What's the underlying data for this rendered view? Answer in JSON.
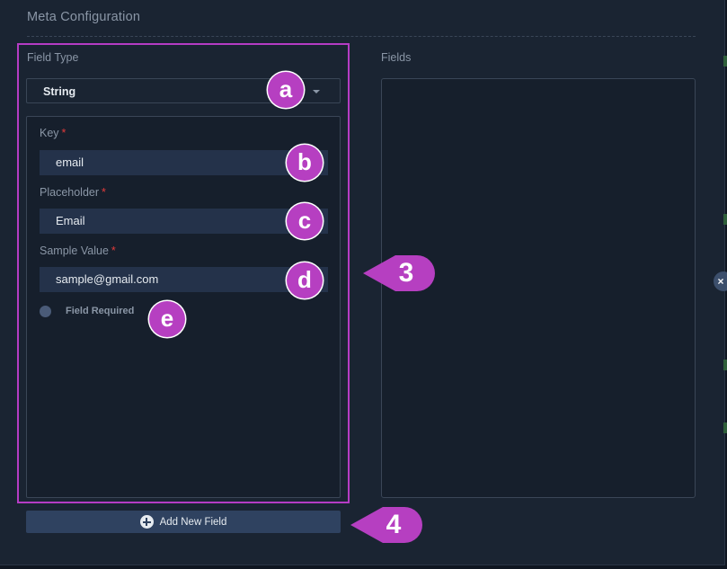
{
  "panel": {
    "title": "Meta Configuration"
  },
  "left": {
    "field_type_label": "Field Type",
    "field_type_value": "String",
    "key_label": "Key",
    "key_value": "email",
    "placeholder_label": "Placeholder",
    "placeholder_value": "Email",
    "sample_label": "Sample Value",
    "sample_value": "sample@gmail.com",
    "required_marker": "*",
    "field_required_label": "Field Required",
    "field_required_checked": false
  },
  "right": {
    "fields_label": "Fields"
  },
  "footer": {
    "add_button_label": "Add New Field"
  },
  "close_button_label": "×",
  "annotations": {
    "a": "a",
    "b": "b",
    "c": "c",
    "d": "d",
    "e": "e",
    "three": "3",
    "four": "4"
  },
  "colors": {
    "annotation": "#b63fc1",
    "highlight_border": "#b53cc4",
    "required": "#e23b3b",
    "button_bg": "#2f4260"
  },
  "icons": {
    "add": "plus-circle-icon",
    "dropdown": "chevron-down-icon",
    "close": "close-icon"
  }
}
